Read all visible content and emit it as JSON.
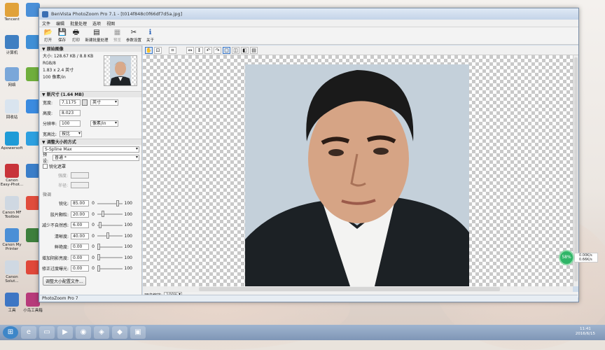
{
  "app": {
    "title": "BenVista PhotoZoom Pro 7.1 - [t014f848c0f66df7d5a.jpg]",
    "status": "PhotoZoom Pro 7"
  },
  "menu": [
    "文件",
    "编辑",
    "批量处理",
    "选项",
    "视图"
  ],
  "toolbar": [
    {
      "icon": "folder-open-icon",
      "glyph": "📂",
      "label": "打开"
    },
    {
      "icon": "save-icon",
      "glyph": "💾",
      "label": "保存"
    },
    {
      "icon": "print-icon",
      "glyph": "🖶",
      "label": "打印"
    },
    {
      "icon": "batch-icon",
      "glyph": "▤",
      "label": "新建批量处理"
    },
    {
      "icon": "preview-icon",
      "glyph": "▦",
      "label": "预览"
    },
    {
      "icon": "settings-tools-icon",
      "glyph": "✂",
      "label": "参数设置"
    },
    {
      "icon": "info-icon",
      "glyph": "ℹ",
      "label": "关于"
    }
  ],
  "original": {
    "header": "原始图像",
    "size": "大小: 128.67 KB / 8.8 KB",
    "mode": "RGB/8",
    "dims": "1.83 x 2.4 英寸",
    "res": "100 像素/in"
  },
  "newsize": {
    "header": "新尺寸 (1.64 MB)",
    "width_label": "宽度:",
    "width_value": "7.1175",
    "unit": "英寸",
    "height_label": "高度:",
    "height_value": "8.023",
    "res_label": "分辨率:",
    "res_value": "100",
    "res_unit": "像素/in",
    "ratio_label": "宽高比:",
    "ratio_value": "按比"
  },
  "method": {
    "header": "调整大小的方式",
    "algorithm": "S-Spline Max",
    "preset_label": "预设:",
    "preset_value": "普通 *",
    "sharpen_label": "锐化遮罩",
    "strength_label": "强度:",
    "radius_label": "半径:",
    "fine_label": "微调"
  },
  "sliders": [
    {
      "label": "锐化:",
      "value": "85.00",
      "min": "0",
      "max": "100",
      "pos": 0.85
    },
    {
      "label": "胶片颗粒:",
      "value": "20.00",
      "min": "0",
      "max": "100",
      "pos": 0.2
    },
    {
      "label": "减少不自然感:",
      "value": "6.00",
      "min": "0",
      "max": "100",
      "pos": 0.06
    },
    {
      "label": "清晰度:",
      "value": "40.00",
      "min": "0",
      "max": "100",
      "pos": 0.4
    },
    {
      "label": "鲜艳度:",
      "value": "0.00",
      "min": "0",
      "max": "100",
      "pos": 0.0
    },
    {
      "label": "增加阴影亮度:",
      "value": "0.00",
      "min": "0",
      "max": "100",
      "pos": 0.0
    },
    {
      "label": "修正过度曝光:",
      "value": "0.00",
      "min": "0",
      "max": "100",
      "pos": 0.0
    }
  ],
  "profile_button": "调整大小配置文件...",
  "preview": {
    "label": "预览缩放:",
    "zoom": "100%"
  },
  "desktop_icons": [
    "Tencent",
    "",
    "计算机",
    "",
    "网络",
    "",
    "回收站",
    "",
    "Apowersoft",
    "",
    "Canon Easy-Phot...",
    "",
    "Canon MF Toolbox",
    "",
    "Canon My Printer",
    "",
    "Canon Solut...",
    "",
    "工具",
    "小鸟工具箱"
  ],
  "gauge": {
    "percent": "58%",
    "up": "0.00K/s",
    "down": "0.66K/s"
  },
  "clock": {
    "time": "11:41",
    "date": "2016/6/15"
  }
}
